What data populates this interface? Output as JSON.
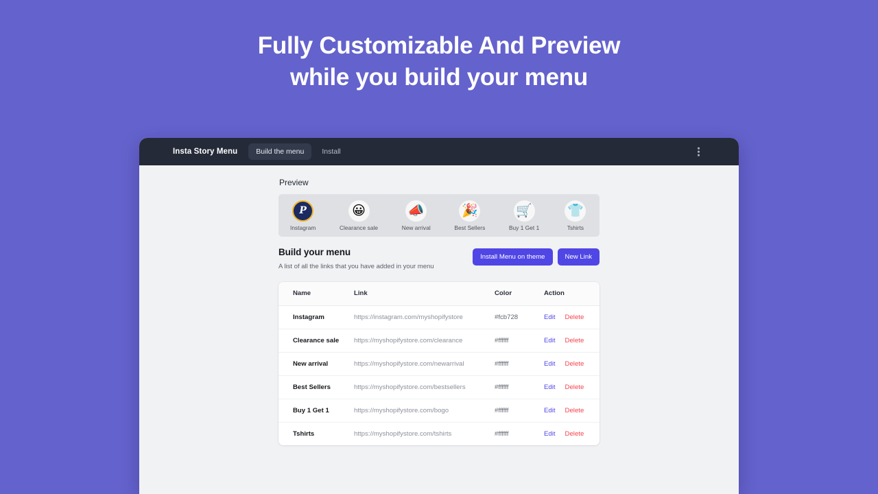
{
  "hero": {
    "line1": "Fully Customizable And Preview",
    "line2": "while you build your menu"
  },
  "colors": {
    "page_background": "#6462cc",
    "topbar": "#252a38",
    "accent": "#4f46e5",
    "delete": "#f5434c",
    "preview_strip": "#dfe0e4"
  },
  "app": {
    "brand": "Insta Story Menu",
    "tabs": [
      {
        "label": "Build the menu",
        "active": true
      },
      {
        "label": "Install",
        "active": false
      }
    ],
    "overflow_icon": "kebab-menu-icon"
  },
  "preview": {
    "label": "Preview",
    "items": [
      {
        "name": "Instagram",
        "icon": "paypal-p-badge-icon",
        "glyph": "P"
      },
      {
        "name": "Clearance sale",
        "icon": "grinning-face-emoji",
        "glyph": "😀"
      },
      {
        "name": "New arrival",
        "icon": "megaphone-emoji",
        "glyph": "📣"
      },
      {
        "name": "Best Sellers",
        "icon": "party-popper-emoji",
        "glyph": "🎉"
      },
      {
        "name": "Buy 1 Get 1",
        "icon": "shopping-cart-emoji",
        "glyph": "🛒"
      },
      {
        "name": "Tshirts",
        "icon": "tshirt-emoji",
        "glyph": "👕"
      }
    ]
  },
  "build": {
    "title": "Build your menu",
    "subtitle": "A list of all the links that you have added in your menu",
    "install_button": "Install Menu on theme",
    "new_link_button": "New Link"
  },
  "table": {
    "headers": {
      "name": "Name",
      "link": "Link",
      "color": "Color",
      "action": "Action"
    },
    "edit_label": "Edit",
    "delete_label": "Delete",
    "rows": [
      {
        "name": "Instagram",
        "link": "https://instagram.com/myshopifystore",
        "color": "#fcb728"
      },
      {
        "name": "Clearance sale",
        "link": "https://myshopifystore.com/clearance",
        "color": "#ffffff"
      },
      {
        "name": "New arrival",
        "link": "https://myshopifystore.com/newarrival",
        "color": "#ffffff"
      },
      {
        "name": "Best Sellers",
        "link": "https://myshopifystore.com/bestsellers",
        "color": "#ffffff"
      },
      {
        "name": "Buy 1 Get 1",
        "link": "https://myshopifystore.com/bogo",
        "color": "#ffffff"
      },
      {
        "name": "Tshirts",
        "link": "https://myshopifystore.com/tshirts",
        "color": "#ffffff"
      }
    ]
  }
}
